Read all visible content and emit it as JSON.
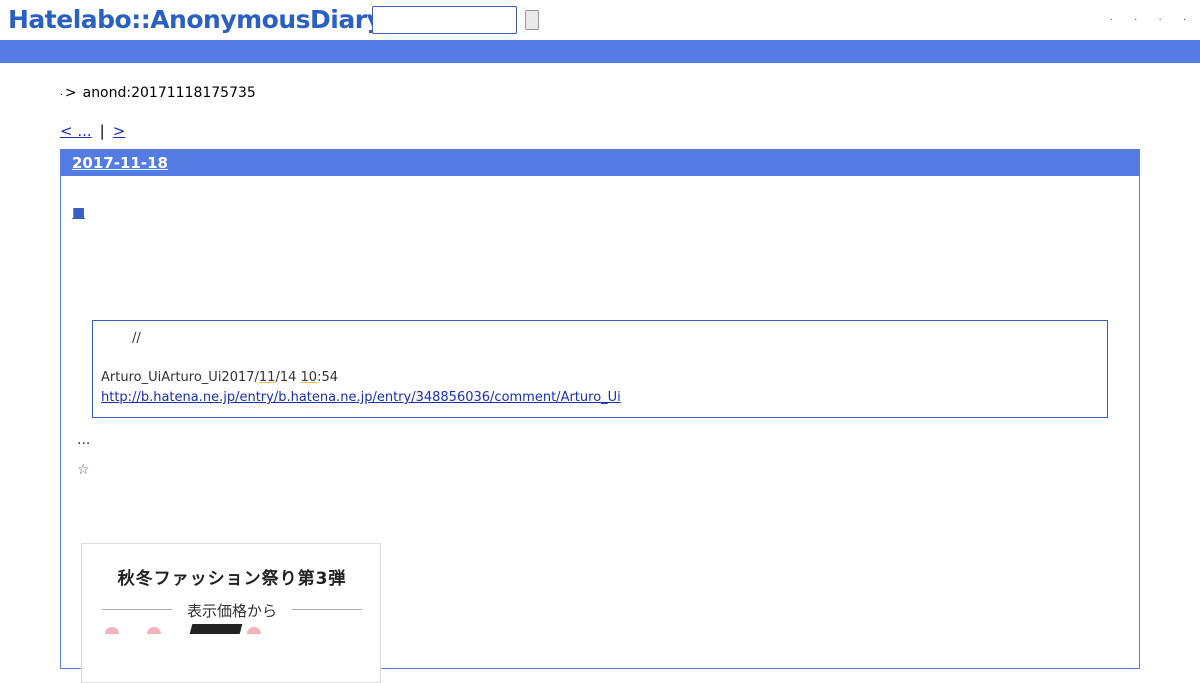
{
  "header": {
    "logo": "Hatelabo::AnonymousDiary",
    "search_placeholder": "",
    "search_button_label": "",
    "links": [
      ".",
      ".",
      ".",
      "."
    ]
  },
  "breadcrumb": {
    "root": ".",
    "separator": ">",
    "current": "anond:20171118175735"
  },
  "pager": {
    "prev_label": "< ...",
    "separator": "|",
    "next_label": ">"
  },
  "day": {
    "date": "2017-11-18",
    "section_mark": "■",
    "quote": {
      "line1": "//",
      "author": "Arturo_UiArturo_Ui2017/",
      "month": "11",
      "day": "/14 ",
      "hour": "10",
      "minute": ":54",
      "link": "http://b.hatena.ne.jp/entry/b.hatena.ne.jp/entry/348856036/comment/Arturo_Ui"
    },
    "ellipsis": "...",
    "star": "☆"
  },
  "ad": {
    "title": "秋冬ファッション祭り第3弾",
    "subtitle": "表示価格から"
  },
  "colors": {
    "brand_blue": "#557ce5",
    "logo_blue": "#2a5fc4",
    "link_blue": "#1b2fb5"
  }
}
